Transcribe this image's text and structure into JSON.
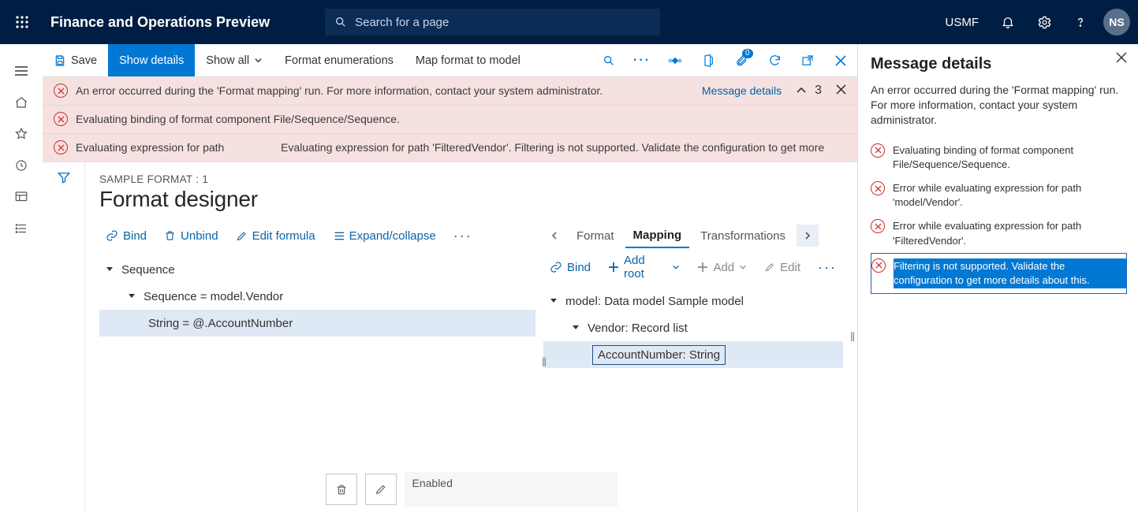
{
  "header": {
    "app_title": "Finance and Operations Preview",
    "search_placeholder": "Search for a page",
    "company": "USMF",
    "avatar_initials": "NS"
  },
  "action_bar": {
    "save": "Save",
    "show_details": "Show details",
    "show_all": "Show all",
    "format_enum": "Format enumerations",
    "map_format": "Map format to model",
    "badge_count": "0"
  },
  "errors": {
    "rows": [
      "An error occurred during the 'Format mapping' run. For more information, contact your system administrator.",
      "Evaluating binding of format component File/Sequence/Sequence.",
      "Evaluating expression for path"
    ],
    "row3_right": "Evaluating expression for path 'FilteredVendor'. Filtering is not supported. Validate the configuration to get more",
    "details_link": "Message details",
    "count": "3"
  },
  "designer": {
    "crumb": "SAMPLE FORMAT : 1",
    "title": "Format designer",
    "left_cmds": {
      "bind": "Bind",
      "unbind": "Unbind",
      "edit_formula": "Edit formula",
      "expand": "Expand/collapse"
    },
    "right_cmds": {
      "bind": "Bind",
      "add_root": "Add root",
      "add": "Add",
      "edit": "Edit"
    },
    "tabs": {
      "format": "Format",
      "mapping": "Mapping",
      "transformations": "Transformations"
    },
    "left_tree": {
      "n1": "Sequence",
      "n2": "Sequence = model.Vendor",
      "n3": "String = @.AccountNumber"
    },
    "right_tree": {
      "n1": "model: Data model Sample model",
      "n2": "Vendor: Record list",
      "n3": "AccountNumber: String"
    },
    "enabled_label": "Enabled"
  },
  "msg_panel": {
    "title": "Message details",
    "summary": "An error occurred during the 'Format mapping' run. For more information, contact your system administrator.",
    "items": [
      "Evaluating binding of format component File/Sequence/Sequence.",
      "Error while evaluating expression for path 'model/Vendor'.",
      "Error while evaluating expression for path 'FilteredVendor'.",
      "Filtering is not supported. Validate the configuration to get more details about this."
    ]
  }
}
